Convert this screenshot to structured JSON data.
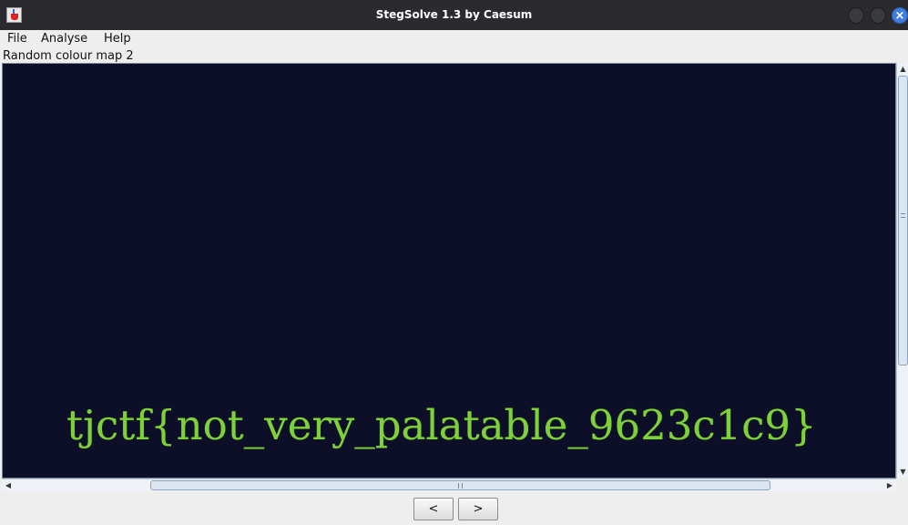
{
  "window": {
    "title": "StegSolve 1.3 by Caesum",
    "close_glyph": "×"
  },
  "menu": {
    "items": [
      "File",
      "Analyse",
      "Help"
    ]
  },
  "mode_label": "Random colour map 2",
  "image": {
    "background_color": "#0d0e28",
    "text_color": "#7fd13a",
    "visible_text": "tjctf{not_very_palatable_9623c1c9}"
  },
  "scrollbars": {
    "up_arrow": "▲",
    "down_arrow": "▼",
    "left_arrow": "◀",
    "right_arrow": "▶"
  },
  "nav": {
    "prev_label": "<",
    "next_label": ">"
  }
}
